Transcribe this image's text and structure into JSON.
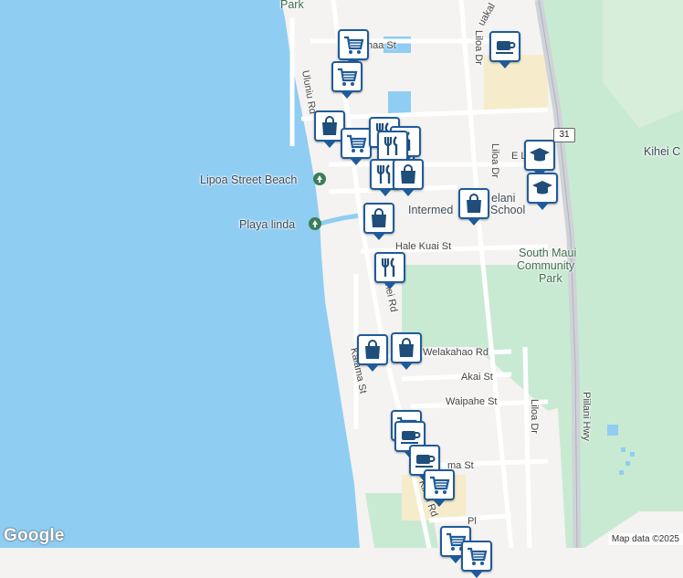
{
  "map": {
    "colors": {
      "water": "#8fcdf3",
      "land": "#f4f3f1",
      "park": "#c9ead2",
      "road": "#ffffff",
      "highway": "#cfd3d8",
      "yellow": "#f6eccb",
      "pin": "#1f5b9a"
    },
    "labels": {
      "park_top": "Park",
      "lipoa_street_beach": "Lipoa Street Beach",
      "playa_linda": "Playa linda",
      "intermediate_school": "Intermed",
      "kihei_c": "Kihei C",
      "south_maui_community_park_1": "South Maui",
      "south_maui_community_park_2": "Community",
      "south_maui_community_park_3": "Park",
      "school_suffix": "elani",
      "school_suffix2": "School"
    },
    "roads": {
      "ohaa_st": "haa St",
      "uluniu_rd": "Uluniu Rd",
      "liloa_dr_top": "Liloa Dr",
      "liloa_dr_mid": "Liloa Dr",
      "liloa_dr_low": "Liloa Dr",
      "kuakaha": "uakal",
      "e_l": "E L",
      "hale_kuai_st": "Hale Kuai St",
      "kihei_rd_mid": "hei Rd",
      "kihei_rd_low": "Kihei Rd",
      "welakahao_rd": "Welakahao Rd",
      "akai_st": "Akai St",
      "waipahe_st": "Waipahe St",
      "kalama": "Kalama St",
      "piilani_hwy": "Piilani Hwy",
      "hwy_31": "31",
      "ma_st": "ma St",
      "pl": "Pl"
    },
    "pins": [
      {
        "type": "shopping-cart"
      },
      {
        "type": "coffee"
      },
      {
        "type": "shopping-cart"
      },
      {
        "type": "shopping-bag"
      },
      {
        "type": "shopping-bag"
      },
      {
        "type": "shopping-cart"
      },
      {
        "type": "restaurant"
      },
      {
        "type": "restaurant"
      },
      {
        "type": "restaurant"
      },
      {
        "type": "restaurant"
      },
      {
        "type": "shopping-bag"
      },
      {
        "type": "shopping-bag"
      },
      {
        "type": "school"
      },
      {
        "type": "school"
      },
      {
        "type": "shopping-bag"
      },
      {
        "type": "restaurant"
      },
      {
        "type": "shopping-bag"
      },
      {
        "type": "shopping-bag"
      },
      {
        "type": "shopping-cart"
      },
      {
        "type": "coffee"
      },
      {
        "type": "coffee"
      },
      {
        "type": "shopping-cart"
      },
      {
        "type": "shopping-cart"
      },
      {
        "type": "shopping-cart"
      }
    ],
    "logo": "Google",
    "attribution": "Map data ©2025"
  }
}
